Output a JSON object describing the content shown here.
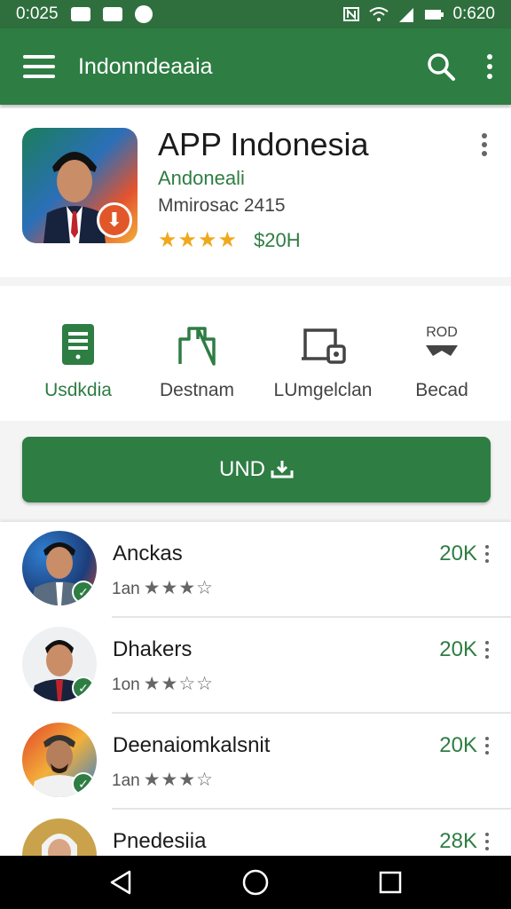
{
  "status_bar": {
    "time_left": "0:025",
    "time_right": "0:620"
  },
  "app_bar": {
    "title": "Indonndeaaia"
  },
  "app": {
    "title": "APP Indonesia",
    "developer": "Andoneali",
    "meta": "Mmirosac 2415",
    "rating_stars": "★★★★",
    "price": "$20H"
  },
  "actions": [
    {
      "label": "Usdkdia",
      "icon": "document-icon"
    },
    {
      "label": "Destnam",
      "icon": "share-icon"
    },
    {
      "label": "LUmgelclan",
      "icon": "device-icon"
    },
    {
      "label": "Becad",
      "icon": "rod-badge-icon",
      "caption": "ROD"
    }
  ],
  "install_button": {
    "label": "UND"
  },
  "list": [
    {
      "name": "Anckas",
      "sub": "1an",
      "stars": "★★★☆",
      "count": "20K"
    },
    {
      "name": "Dhakers",
      "sub": "1on",
      "stars": "★★☆☆",
      "count": "20K"
    },
    {
      "name": "Deenaiomkalsnit",
      "sub": "1an",
      "stars": "★★★☆",
      "count": "20K"
    },
    {
      "name": "Pnedesiia",
      "sub": "",
      "stars": "",
      "count": "28K"
    }
  ],
  "colors": {
    "primary": "#2e7d43",
    "star": "#f0a81c",
    "badge_orange": "#e2572a"
  }
}
